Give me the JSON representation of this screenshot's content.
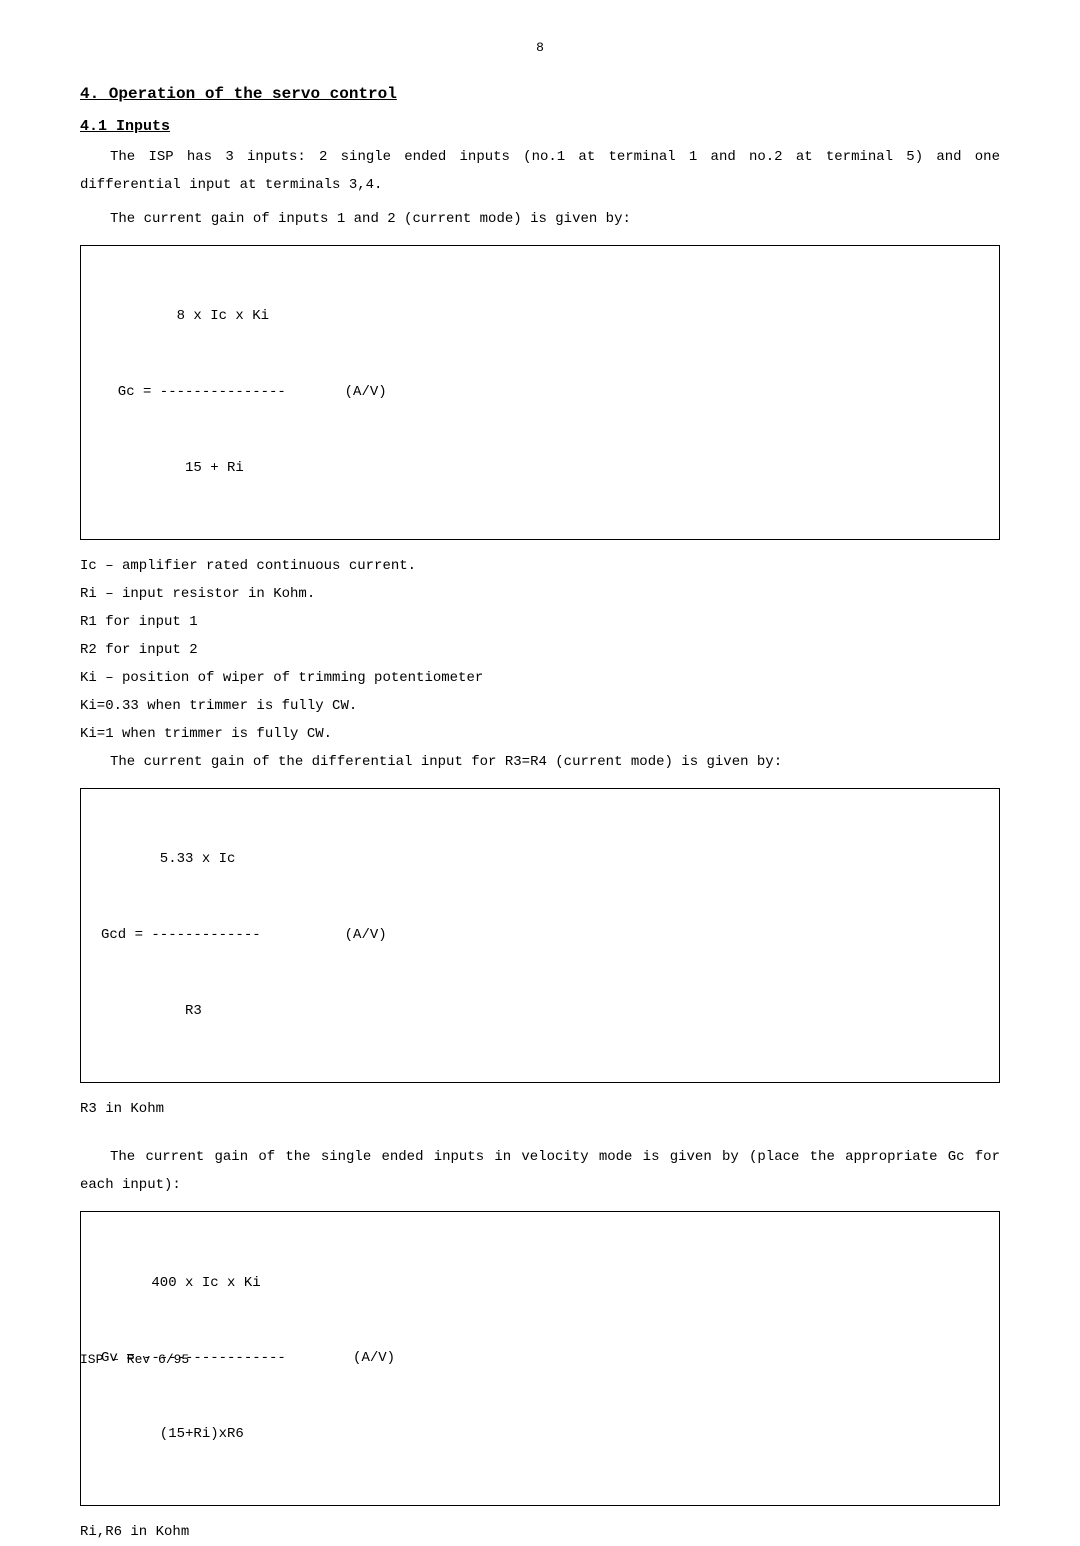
{
  "page_number": "8",
  "section_heading": "4.  Operation of the servo control",
  "subsection_heading": "4.1  Inputs",
  "para1": "The ISP has 3 inputs: 2 single ended inputs (no.1 at terminal 1 and no.2 at terminal 5) and one differential input at terminals 3,4.",
  "para2": "The current gain of inputs 1 and 2 (current mode) is given by:",
  "formula1": {
    "line1": "         8 x Ic x Ki",
    "line2": "  Gc = ---------------       (A/V)",
    "line3": "          15 + Ri"
  },
  "def1": "Ic – amplifier rated continuous current.",
  "def2": "Ri – input resistor in Kohm.",
  "def2a": "      R1 for input 1",
  "def2b": "      R2 for input 2",
  "def3": "Ki – position of wiper of trimming potentiometer",
  "def3a": "      Ki=0.33 when trimmer is fully CW.",
  "def3b": "      Ki=1 when trimmer is fully CW.",
  "para3": "The current gain of the differential input for R3=R4 (current mode) is given by:",
  "formula2": {
    "line1": "       5.33 x Ic",
    "line2": "Gcd = -------------          (A/V)",
    "line3": "          R3"
  },
  "note2": "R3 in Kohm",
  "para4": "The current gain of the single ended inputs in velocity mode is given by (place the appropriate Gc for each input):",
  "formula3": {
    "line1": "      400 x Ic x Ki",
    "line2": "Gv = -----------------        (A/V)",
    "line3": "       (15+Ri)xR6"
  },
  "note3": "Ri,R6 in Kohm",
  "footer": "ISP – Rev 6/95"
}
